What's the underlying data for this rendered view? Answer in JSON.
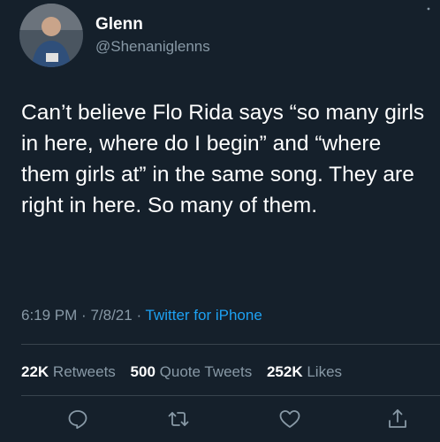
{
  "user": {
    "display_name": "Glenn",
    "handle": "@Shenaniglenns"
  },
  "tweet": {
    "text": "Can’t believe Flo Rida says “so many girls in here, where do I begin” and “where them girls at” in the same song. They are right in here. So many of them.",
    "time": "6:19 PM",
    "date": "7/8/21",
    "source": "Twitter for iPhone"
  },
  "stats": {
    "retweets_count": "22K",
    "retweets_label": "Retweets",
    "quotes_count": "500",
    "quotes_label": "Quote Tweets",
    "likes_count": "252K",
    "likes_label": "Likes"
  },
  "colors": {
    "background": "#15202b",
    "secondary_text": "#8899a6",
    "link": "#1da1f2",
    "divider": "#38444d"
  },
  "icons": [
    "reply-icon",
    "retweet-icon",
    "like-icon",
    "share-icon"
  ]
}
